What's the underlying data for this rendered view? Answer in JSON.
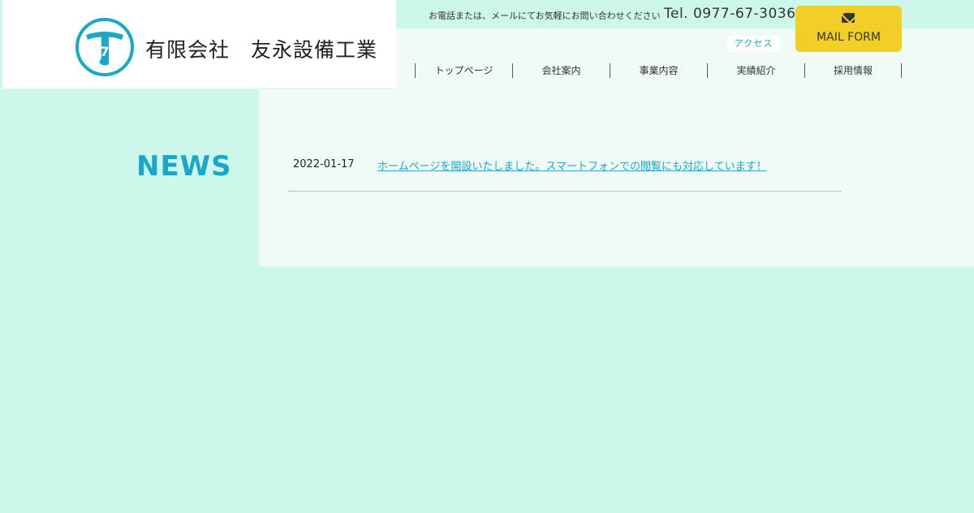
{
  "brand": {
    "logo_mark_letter": "T",
    "logo_mark_sub": "7",
    "company_name": "有限会社　友永設備工業"
  },
  "header": {
    "contact_text": "お電話または、メールにてお気軽にお問い合わせください",
    "tel": "Tel. 0977-67-3036",
    "mail_button_label": "MAIL FORM",
    "mail_icon": "envelope-icon",
    "access_label": "アクセス"
  },
  "nav": {
    "items": [
      {
        "label": "トップページ"
      },
      {
        "label": "会社案内"
      },
      {
        "label": "事業内容"
      },
      {
        "label": "実績紹介"
      },
      {
        "label": "採用情報"
      }
    ]
  },
  "news": {
    "heading": "NEWS",
    "items": [
      {
        "date": "2022-01-17",
        "title": "ホームページを開設いたしました。スマートフォンでの閲覧にも対応しています！"
      }
    ]
  },
  "colors": {
    "background": "#cdf7ea",
    "panel": "#f0fbf8",
    "accent": "#1aa7c9",
    "button": "#f2cf27"
  }
}
